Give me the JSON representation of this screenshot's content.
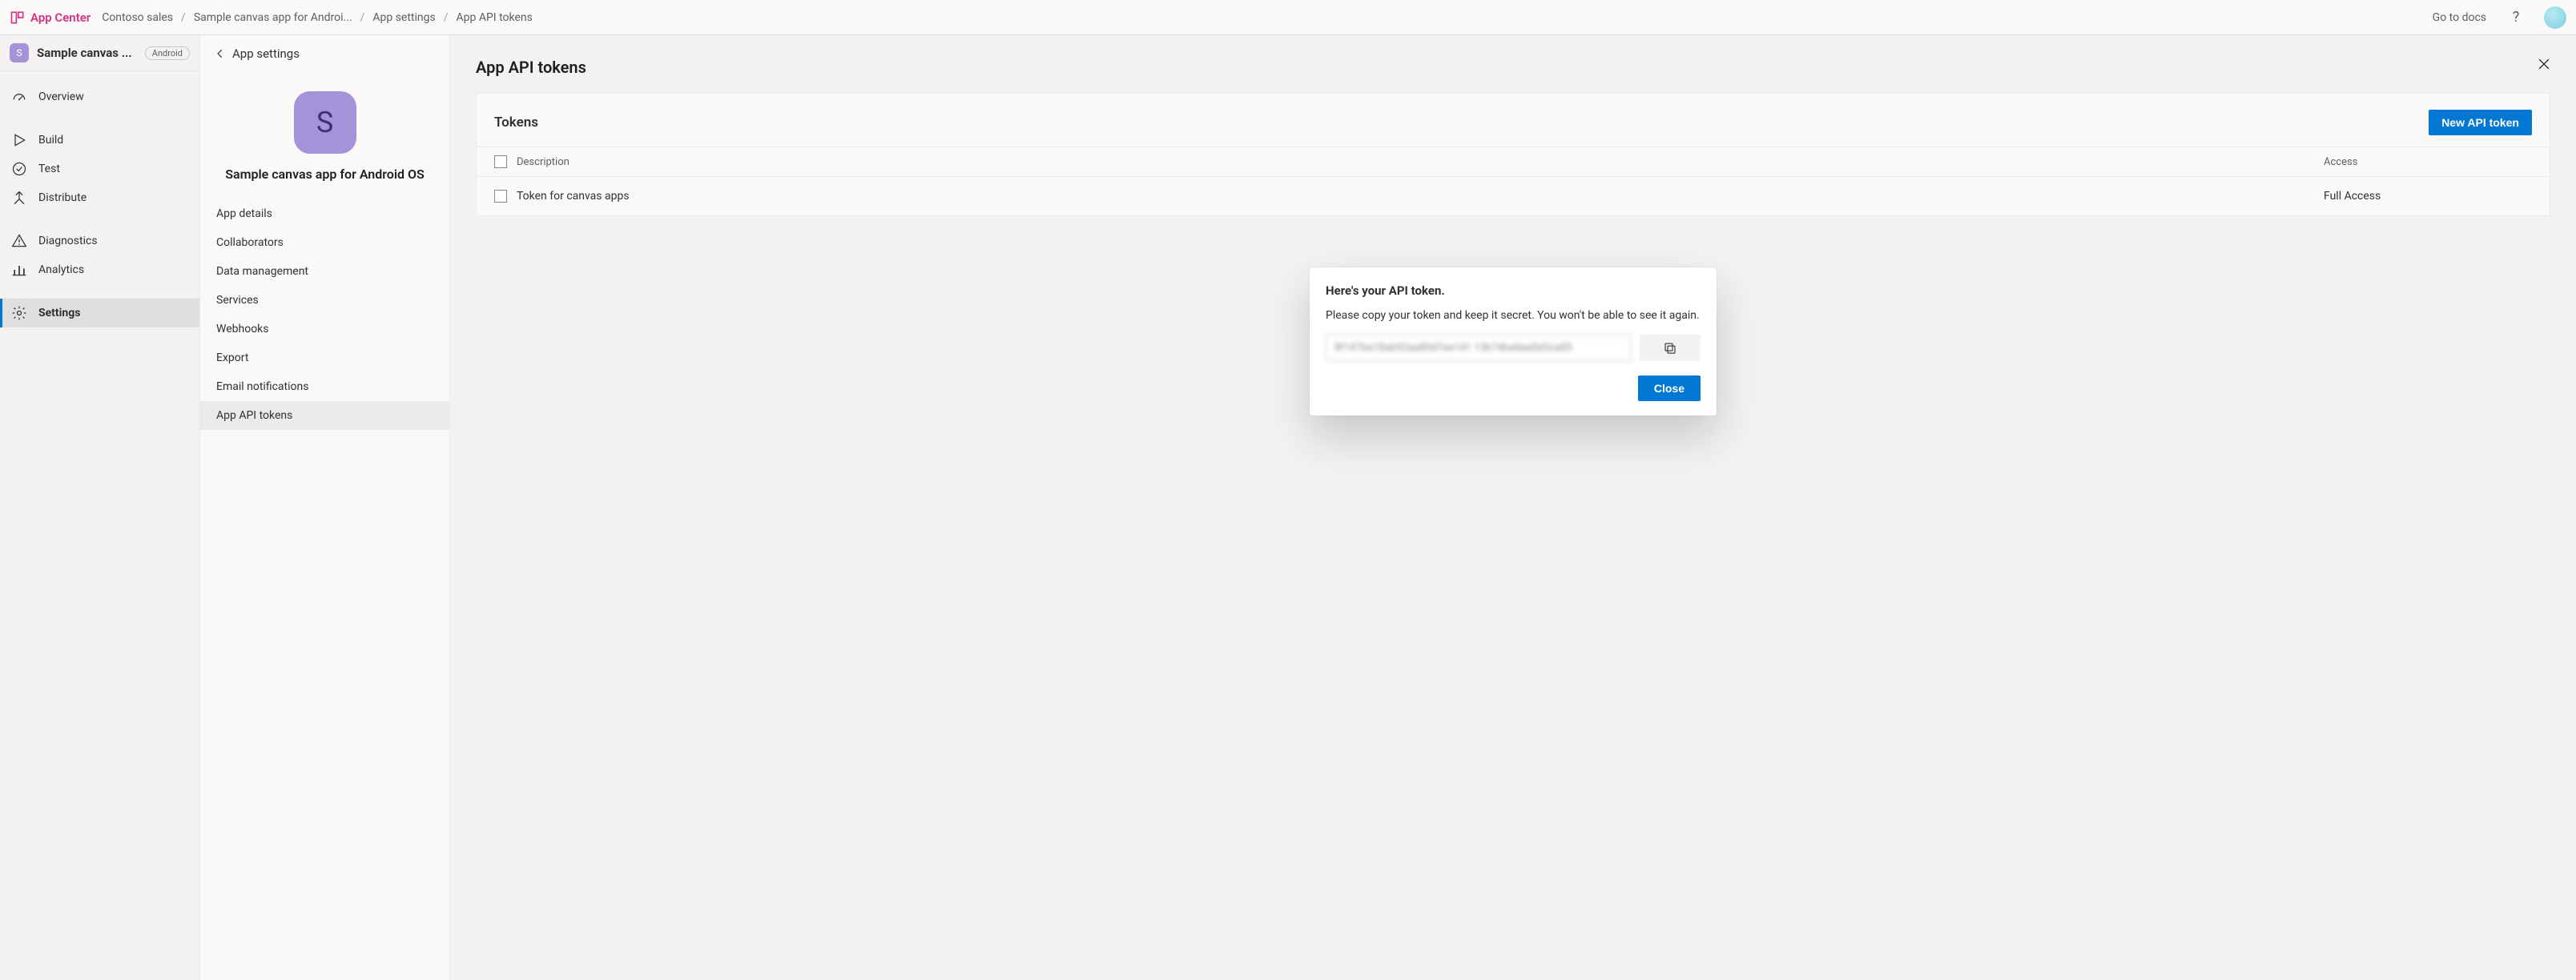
{
  "header": {
    "brand": "App Center",
    "breadcrumbs": [
      "Contoso sales",
      "Sample canvas app for Androi...",
      "App settings",
      "App API tokens"
    ],
    "docs_link": "Go to docs"
  },
  "sidebar": {
    "app_icon_letter": "S",
    "app_name_truncated": "Sample canvas ...",
    "platform": "Android",
    "items": [
      {
        "label": "Overview",
        "icon": "gauge-icon"
      },
      {
        "label": "Build",
        "icon": "play-icon"
      },
      {
        "label": "Test",
        "icon": "check-circle-icon"
      },
      {
        "label": "Distribute",
        "icon": "distribute-icon"
      },
      {
        "label": "Diagnostics",
        "icon": "warning-icon"
      },
      {
        "label": "Analytics",
        "icon": "bar-chart-icon"
      },
      {
        "label": "Settings",
        "icon": "gear-icon"
      }
    ],
    "active_index": 6
  },
  "settings_panel": {
    "back_label": "App settings",
    "app_icon_letter": "S",
    "app_title": "Sample canvas app for Android OS",
    "items": [
      "App details",
      "Collaborators",
      "Data management",
      "Services",
      "Webhooks",
      "Export",
      "Email notifications",
      "App API tokens"
    ],
    "active_index": 7
  },
  "main": {
    "title": "App API tokens",
    "tokens_card": {
      "heading": "Tokens",
      "new_button": "New API token",
      "columns": {
        "description": "Description",
        "access": "Access"
      },
      "rows": [
        {
          "description": "Token for canvas apps",
          "access": "Full Access"
        }
      ]
    }
  },
  "modal": {
    "title": "Here's your API token.",
    "subtitle": "Please copy your token and keep it secret. You won't be able to see it again.",
    "token_value": "8f147ba18ab92aa80d7ee141 13b74ba8aa0d3ca85",
    "close_label": "Close"
  }
}
